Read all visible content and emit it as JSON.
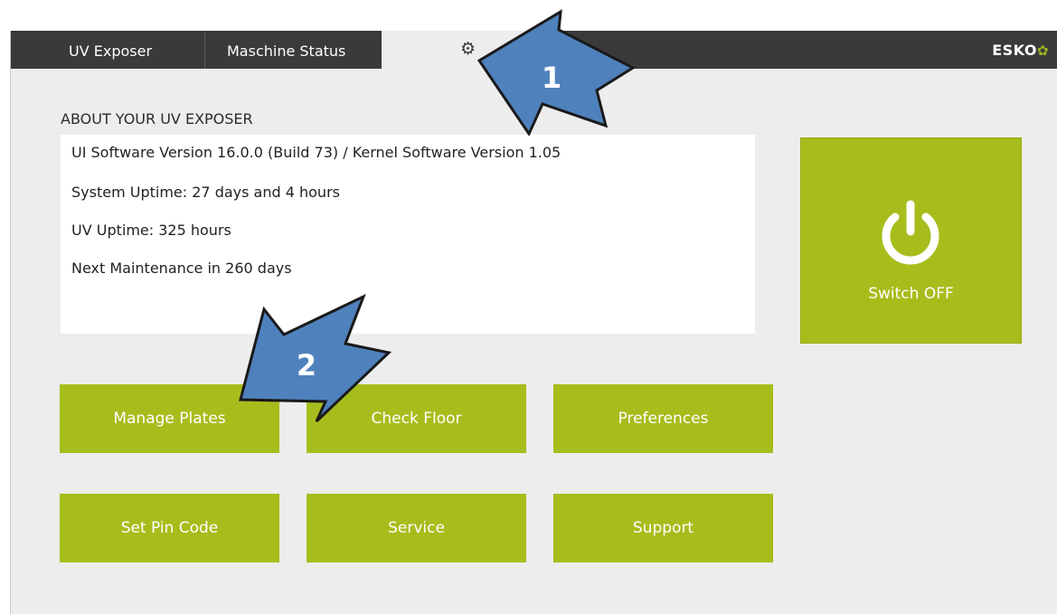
{
  "tabs": {
    "uv_exposer": "UV Exposer",
    "machine_status": "Maschine Status",
    "settings_icon": "gear-icon"
  },
  "brand": {
    "logo_text": "ESKO"
  },
  "about": {
    "title": "ABOUT YOUR UV EXPOSER",
    "lines": [
      "UI Software Version 16.0.0 (Build 73) / Kernel Software Version 1.05",
      "System Uptime: 27 days and 4 hours",
      "UV Uptime: 325 hours",
      "Next Maintenance in 260 days"
    ]
  },
  "power": {
    "label": "Switch OFF",
    "icon": "power-icon"
  },
  "actions": {
    "manage_plates": "Manage Plates",
    "check_floor": "Check Floor",
    "preferences": "Preferences",
    "set_pin_code": "Set Pin Code",
    "service": "Service",
    "support": "Support"
  },
  "callouts": {
    "one": "1",
    "two": "2"
  },
  "colors": {
    "accent": "#a7bd1c",
    "tabbar": "#3a3a3a",
    "background": "#ecedec",
    "callout": "#4f81bd"
  }
}
